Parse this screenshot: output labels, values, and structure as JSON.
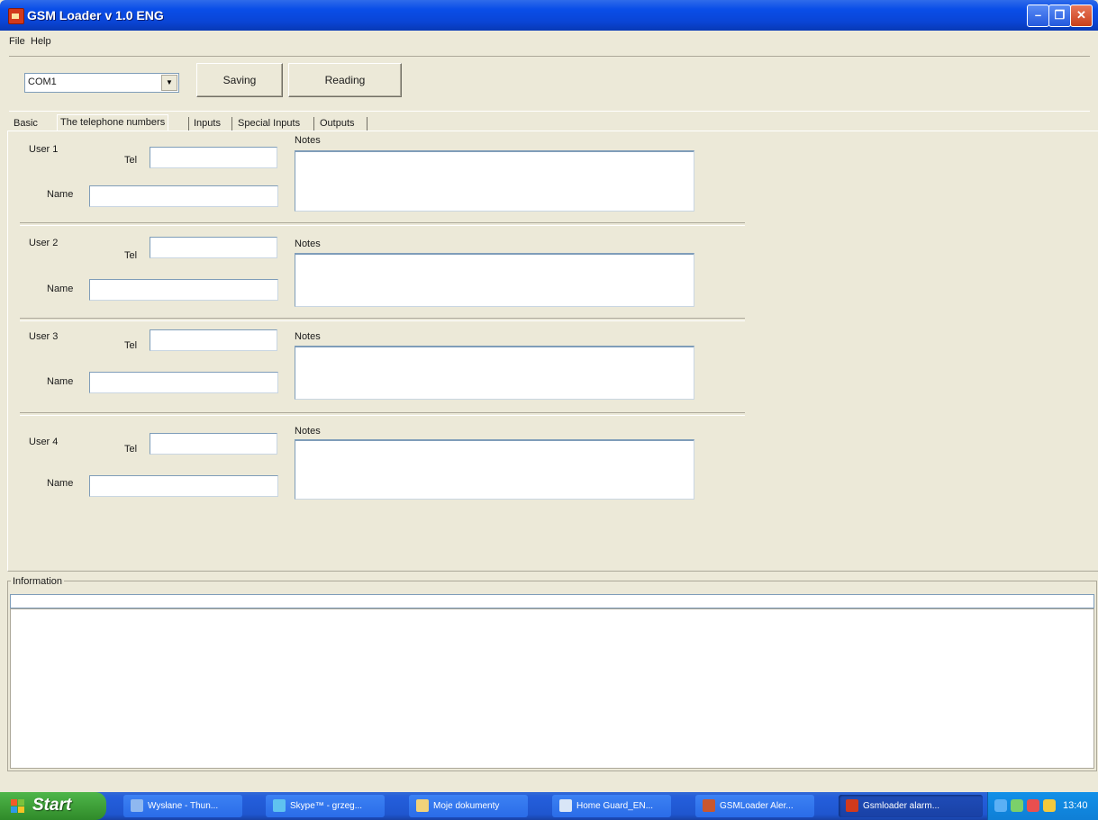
{
  "window": {
    "title": "GSM Loader v 1.0 ENG"
  },
  "menu": [
    "File",
    "Help"
  ],
  "toolbar": {
    "port_value": "COM1",
    "saving_label": "Saving",
    "reading_label": "Reading"
  },
  "tabs": [
    {
      "label": "Basic",
      "active": false
    },
    {
      "label": "The telephone numbers",
      "active": true
    },
    {
      "label": "Inputs",
      "active": false
    },
    {
      "label": "Special Inputs",
      "active": false
    },
    {
      "label": "Outputs",
      "active": false
    }
  ],
  "users": [
    {
      "label": "User 1",
      "tel_label": "Tel",
      "name_label": "Name",
      "notes_label": "Notes"
    },
    {
      "label": "User 2",
      "tel_label": "Tel",
      "name_label": "Name",
      "notes_label": "Notes"
    },
    {
      "label": "User 3",
      "tel_label": "Tel",
      "name_label": "Name",
      "notes_label": "Notes"
    },
    {
      "label": "User 4",
      "tel_label": "Tel",
      "name_label": "Name",
      "notes_label": "Notes"
    }
  ],
  "information": {
    "label": "Information"
  },
  "taskbar": {
    "start_label": "Start",
    "tasks": [
      {
        "label": "Wysłane - Thun...",
        "icon_color": "#8fb8f0"
      },
      {
        "label": "Skype™ - grzeg...",
        "icon_color": "#5fc3f0"
      },
      {
        "label": "Moje dokumenty",
        "icon_color": "#f1d27a"
      },
      {
        "label": "Home Guard_EN...",
        "icon_color": "#d9e6f7"
      },
      {
        "label": "GSMLoader Aler...",
        "icon_color": "#c9572f"
      },
      {
        "label": "Gsmloader alarm...",
        "icon_color": "#d23a1c"
      }
    ],
    "clock": "13:40"
  }
}
